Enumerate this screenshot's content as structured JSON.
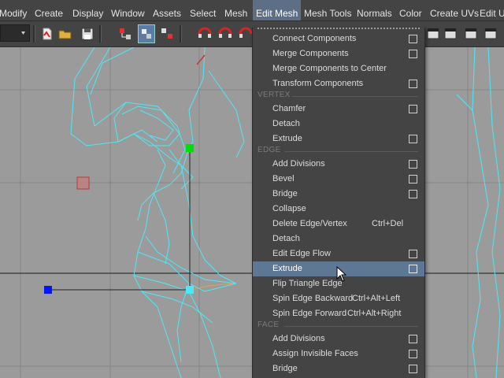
{
  "menubar": {
    "items": [
      "Modify",
      "Create",
      "Display",
      "Window",
      "Assets",
      "Select",
      "Mesh",
      "Edit Mesh",
      "Mesh Tools",
      "Normals",
      "Color",
      "Create UVs",
      "Edit UVs"
    ]
  },
  "toolbar": {
    "icons": [
      "caret-down-icon",
      "new-scene-icon",
      "open-scene-icon",
      "save-scene-icon",
      "select-hierarchy-icon",
      "select-object-icon",
      "select-component-icon",
      "snap-curve-icon",
      "snap-point-icon",
      "snap-grid-icon",
      "render-icon",
      "ipr-render-icon",
      "render-settings-icon",
      "hypershade-icon"
    ]
  },
  "edit_mesh_menu": {
    "items": [
      {
        "label": "Connect Components",
        "shortcut": "",
        "option": true
      },
      {
        "label": "Merge Components",
        "shortcut": "",
        "option": true
      },
      {
        "label": "Merge Components to Center",
        "shortcut": "",
        "option": false
      },
      {
        "label": "Transform Components",
        "shortcut": "",
        "option": true
      }
    ],
    "section_vertex": "VERTEX",
    "vertex_items": [
      {
        "label": "Chamfer",
        "shortcut": "",
        "option": true
      },
      {
        "label": "Detach",
        "shortcut": "",
        "option": false
      },
      {
        "label": "Extrude",
        "shortcut": "",
        "option": true
      }
    ],
    "section_edge": "EDGE",
    "edge_items": [
      {
        "label": "Add Divisions",
        "shortcut": "",
        "option": true
      },
      {
        "label": "Bevel",
        "shortcut": "",
        "option": true
      },
      {
        "label": "Bridge",
        "shortcut": "",
        "option": true
      },
      {
        "label": "Collapse",
        "shortcut": "",
        "option": false
      },
      {
        "label": "Delete Edge/Vertex",
        "shortcut": "Ctrl+Del",
        "option": false
      },
      {
        "label": "Detach",
        "shortcut": "",
        "option": false
      },
      {
        "label": "Edit Edge Flow",
        "shortcut": "",
        "option": true
      },
      {
        "label": "Extrude",
        "shortcut": "",
        "option": true,
        "highlighted": true
      },
      {
        "label": "Flip Triangle Edge",
        "shortcut": "",
        "option": false
      },
      {
        "label": "Spin Edge Backward",
        "shortcut": "Ctrl+Alt+Left",
        "option": false
      },
      {
        "label": "Spin Edge Forward",
        "shortcut": "Ctrl+Alt+Right",
        "option": false
      }
    ],
    "section_face": "FACE",
    "face_items": [
      {
        "label": "Add Divisions",
        "shortcut": "",
        "option": true
      },
      {
        "label": "Assign Invisible Faces",
        "shortcut": "",
        "option": true
      },
      {
        "label": "Bridge",
        "shortcut": "",
        "option": true
      }
    ]
  },
  "colors": {
    "ui_dark": "#444444",
    "menu_highlight": "#5d7794",
    "viewport_bg": "#9b9b9b",
    "wireframe": "#4ee8f5",
    "manipulator_green": "#00e000",
    "manipulator_blue": "#0014ff",
    "manipulator_center": "#4ee8f5"
  }
}
